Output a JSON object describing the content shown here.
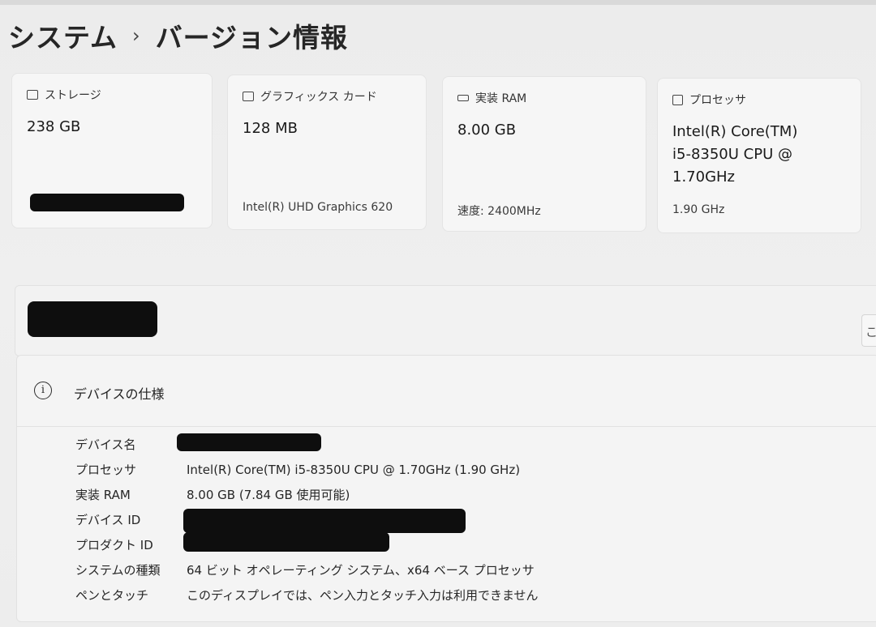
{
  "breadcrumb": {
    "parent": "システム",
    "separator": "›",
    "current": "バージョン情報"
  },
  "cards": {
    "storage": {
      "label": "ストレージ",
      "value": "238 GB"
    },
    "graphics": {
      "label": "グラフィックス カード",
      "value": "128 MB",
      "sub": "Intel(R) UHD Graphics 620"
    },
    "ram": {
      "label": "実装 RAM",
      "value": "8.00 GB",
      "sub": "速度: 2400MHz"
    },
    "processor": {
      "label": "プロセッサ",
      "value_line1": "Intel(R) Core(TM)",
      "value_line2": "i5-8350U CPU @",
      "value_line3": "1.70GHz",
      "sub": "1.90 GHz"
    }
  },
  "rename_hint": "こ",
  "spec": {
    "title": "デバイスの仕様",
    "rows": [
      {
        "key": "デバイス名",
        "value": ""
      },
      {
        "key": "プロセッサ",
        "value": "Intel(R) Core(TM) i5-8350U CPU @ 1.70GHz (1.90 GHz)"
      },
      {
        "key": "実装 RAM",
        "value": "8.00 GB (7.84 GB 使用可能)"
      },
      {
        "key": "デバイス ID",
        "value": ""
      },
      {
        "key": "プロダクト ID",
        "value": ""
      },
      {
        "key": "システムの種類",
        "value": "64 ビット オペレーティング システム、x64 ベース プロセッサ"
      },
      {
        "key": "ペンとタッチ",
        "value": "このディスプレイでは、ペン入力とタッチ入力は利用できません"
      }
    ]
  }
}
